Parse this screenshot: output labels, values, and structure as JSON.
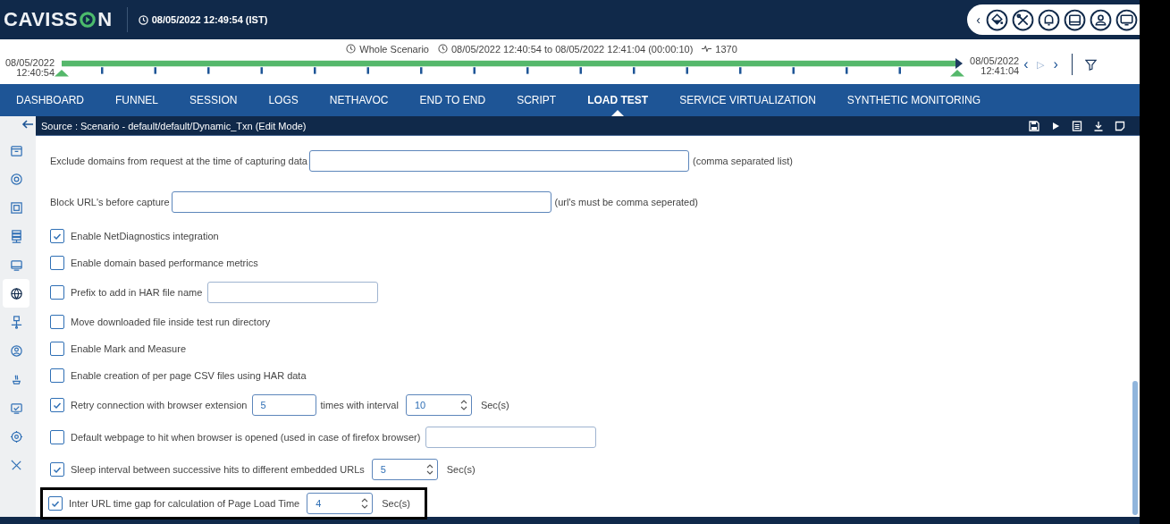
{
  "header": {
    "logo_start": "CAVISS",
    "logo_end": "N",
    "datetime": "08/05/2022 12:49:54 (IST)",
    "toolbar_collapse": "‹"
  },
  "timeline": {
    "start_date": "08/05/2022",
    "start_time": "12:40:54",
    "scope": "Whole Scenario",
    "range": "08/05/2022 12:40:54 to 08/05/2022 12:41:04 (00:00:10)",
    "count": "1370",
    "end_date": "08/05/2022",
    "end_time": "12:41:04",
    "prev": "‹",
    "play": "▷",
    "next": "›"
  },
  "tabs": [
    {
      "label": "DASHBOARD",
      "selected": false
    },
    {
      "label": "FUNNEL",
      "selected": false
    },
    {
      "label": "SESSION",
      "selected": false
    },
    {
      "label": "LOGS",
      "selected": false
    },
    {
      "label": "NETHAVOC",
      "selected": false
    },
    {
      "label": "END TO END",
      "selected": false
    },
    {
      "label": "SCRIPT",
      "selected": false
    },
    {
      "label": "LOAD TEST",
      "selected": true
    },
    {
      "label": "SERVICE VIRTUALIZATION",
      "selected": false
    },
    {
      "label": "SYNTHETIC MONITORING",
      "selected": false
    }
  ],
  "sidebar": {
    "items": [
      {
        "selected": false
      },
      {
        "selected": false
      },
      {
        "selected": false
      },
      {
        "selected": false
      },
      {
        "selected": false
      },
      {
        "selected": true
      },
      {
        "selected": false
      },
      {
        "selected": false
      },
      {
        "selected": false
      },
      {
        "selected": false
      },
      {
        "selected": false
      },
      {
        "selected": false
      }
    ]
  },
  "panel": {
    "title": "Source : Scenario - default/default/Dynamic_Txn (Edit Mode)"
  },
  "form": [
    {
      "kind": "field",
      "label": "Exclude domains from request at the time of capturing data",
      "highlighted": false,
      "controls": [
        {
          "kind": "input"
        },
        {
          "kind": "text",
          "text": "(comma separated list)"
        }
      ]
    },
    {
      "kind": "field",
      "label": "Block URL's before capture",
      "highlighted": false,
      "controls": [
        {
          "kind": "input"
        },
        {
          "kind": "text",
          "text": "(url's must be comma seperated)"
        }
      ]
    },
    {
      "kind": "check",
      "checked": true,
      "label": "Enable NetDiagnostics integration",
      "highlighted": false
    },
    {
      "kind": "check",
      "checked": false,
      "label": "Enable domain based performance metrics",
      "highlighted": false
    },
    {
      "kind": "check",
      "checked": false,
      "label": "Prefix to add in HAR file name",
      "highlighted": false,
      "controls": [
        {
          "kind": "input"
        }
      ]
    },
    {
      "kind": "check",
      "checked": false,
      "label": "Move downloaded file inside test run directory",
      "highlighted": false
    },
    {
      "kind": "check",
      "checked": false,
      "label": "Enable Mark and Measure",
      "highlighted": false
    },
    {
      "kind": "check",
      "checked": false,
      "label": "Enable creation of per page CSV files using HAR data",
      "highlighted": false
    },
    {
      "kind": "check",
      "checked": true,
      "label": "Retry connection with browser extension",
      "highlighted": false,
      "controls": [
        {
          "kind": "input",
          "value": "5"
        },
        {
          "kind": "text",
          "text": "times with interval"
        },
        {
          "kind": "spinner",
          "value": "10"
        },
        {
          "kind": "text",
          "text": "Sec(s)"
        }
      ]
    },
    {
      "kind": "check",
      "checked": false,
      "label": "Default webpage to hit when browser is opened (used in case of firefox browser)",
      "highlighted": false,
      "controls": [
        {
          "kind": "input"
        }
      ]
    },
    {
      "kind": "check",
      "checked": true,
      "label": "Sleep interval between successive hits to different embedded URLs",
      "highlighted": false,
      "controls": [
        {
          "kind": "spinner",
          "value": "5"
        },
        {
          "kind": "text",
          "text": "Sec(s)"
        }
      ]
    },
    {
      "kind": "check",
      "checked": true,
      "label": "Inter URL time gap for calculation of Page Load Time",
      "highlighted": true,
      "controls": [
        {
          "kind": "spinner",
          "value": "4"
        },
        {
          "kind": "text",
          "text": "Sec(s)"
        }
      ]
    }
  ]
}
